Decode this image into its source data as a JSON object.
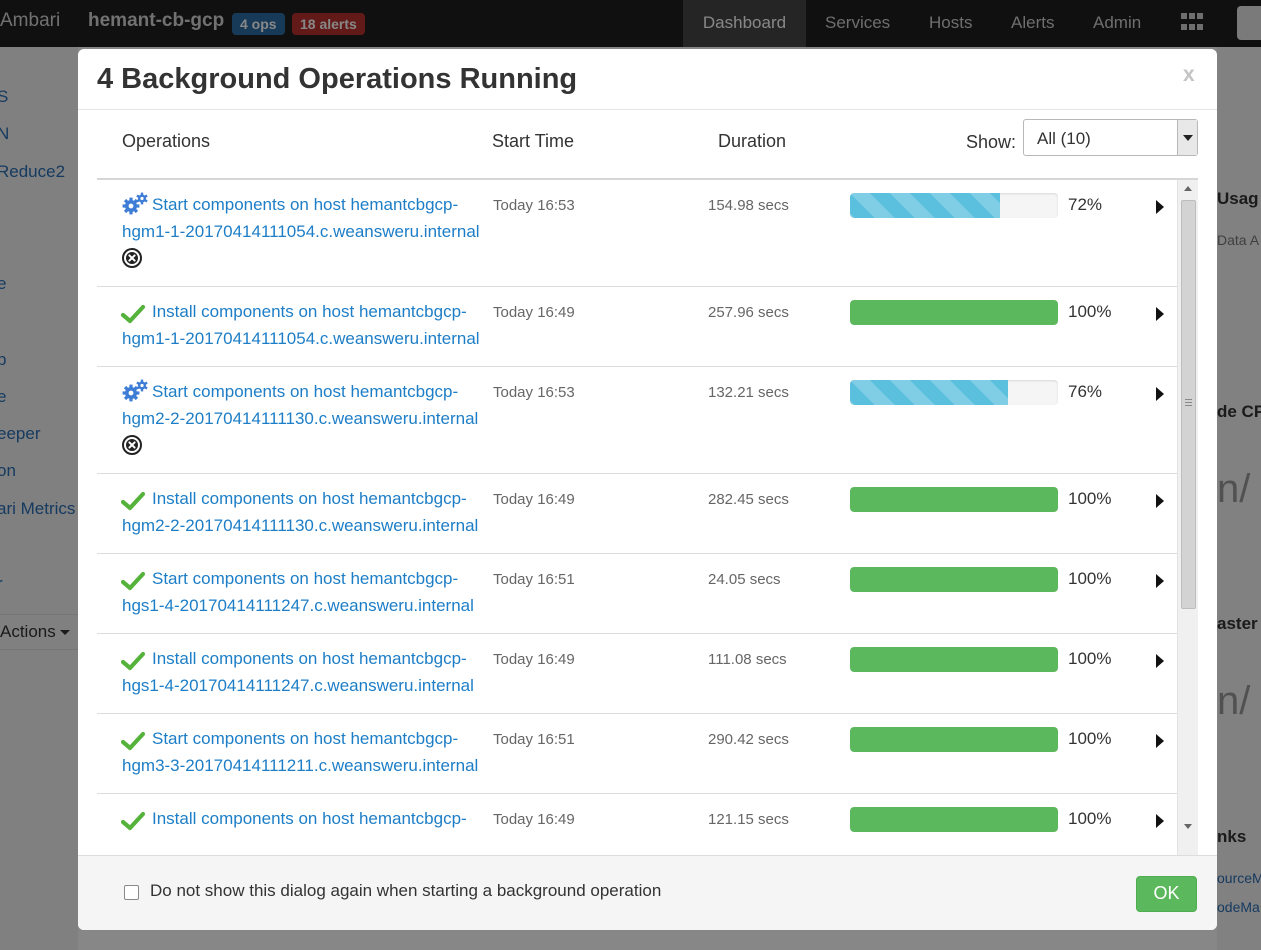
{
  "app": {
    "brand": "Ambari",
    "cluster_name": "hemant-cb-gcp",
    "ops_badge": "4 ops",
    "alerts_badge": "18 alerts",
    "nav": [
      "Dashboard",
      "Services",
      "Hosts",
      "Alerts",
      "Admin"
    ],
    "active_nav": "Dashboard",
    "sidebar_items": [
      "S",
      "N",
      "Reduce2",
      "e",
      "p",
      "e",
      "eeper",
      "on",
      "ari Metrics",
      "r"
    ],
    "sidebar_actions": "Actions",
    "right_fragments": [
      "Usag",
      "Data A",
      "de CP",
      "n/",
      "aster",
      "n/",
      "nks",
      "ourceM",
      "odeMa"
    ]
  },
  "modal": {
    "title": "4 Background Operations Running",
    "close_label": "x",
    "columns": {
      "operations": "Operations",
      "start_time": "Start Time",
      "duration": "Duration"
    },
    "show_label": "Show:",
    "show_value": "All (10)",
    "operations": [
      {
        "status": "running",
        "name": "Start components on host hemantcbgcp-hgm1-1-20170414111054.c.weansweru.internal",
        "start": "Today 16:53",
        "duration": "154.98 secs",
        "progress": 72,
        "percent": "72%",
        "cancelable": true
      },
      {
        "status": "done",
        "name": "Install components on host hemantcbgcp-hgm1-1-20170414111054.c.weansweru.internal",
        "start": "Today 16:49",
        "duration": "257.96 secs",
        "progress": 100,
        "percent": "100%",
        "cancelable": false
      },
      {
        "status": "running",
        "name": "Start components on host hemantcbgcp-hgm2-2-20170414111130.c.weansweru.internal",
        "start": "Today 16:53",
        "duration": "132.21 secs",
        "progress": 76,
        "percent": "76%",
        "cancelable": true
      },
      {
        "status": "done",
        "name": "Install components on host hemantcbgcp-hgm2-2-20170414111130.c.weansweru.internal",
        "start": "Today 16:49",
        "duration": "282.45 secs",
        "progress": 100,
        "percent": "100%",
        "cancelable": false
      },
      {
        "status": "done",
        "name": "Start components on host hemantcbgcp-hgs1-4-20170414111247.c.weansweru.internal",
        "start": "Today 16:51",
        "duration": "24.05 secs",
        "progress": 100,
        "percent": "100%",
        "cancelable": false
      },
      {
        "status": "done",
        "name": "Install components on host hemantcbgcp-hgs1-4-20170414111247.c.weansweru.internal",
        "start": "Today 16:49",
        "duration": "111.08 secs",
        "progress": 100,
        "percent": "100%",
        "cancelable": false
      },
      {
        "status": "done",
        "name": "Start components on host hemantcbgcp-hgm3-3-20170414111211.c.weansweru.internal",
        "start": "Today 16:51",
        "duration": "290.42 secs",
        "progress": 100,
        "percent": "100%",
        "cancelable": false
      },
      {
        "status": "done",
        "name": "Install components on host hemantcbgcp-",
        "start": "Today 16:49",
        "duration": "121.15 secs",
        "progress": 100,
        "percent": "100%",
        "cancelable": false
      }
    ],
    "footer_checkbox_label": "Do not show this dialog again when starting a background operation",
    "ok_label": "OK"
  },
  "colors": {
    "link": "#1d7ec7",
    "progress_done": "#5cb85c",
    "progress_running": "#5bc0de",
    "check_icon": "#55b33c",
    "gear_icon": "#3d7dd6"
  },
  "icons": {
    "running": "gears-icon",
    "done": "check-icon",
    "cancel": "cancel-circle-icon",
    "expand": "caret-right-icon"
  }
}
